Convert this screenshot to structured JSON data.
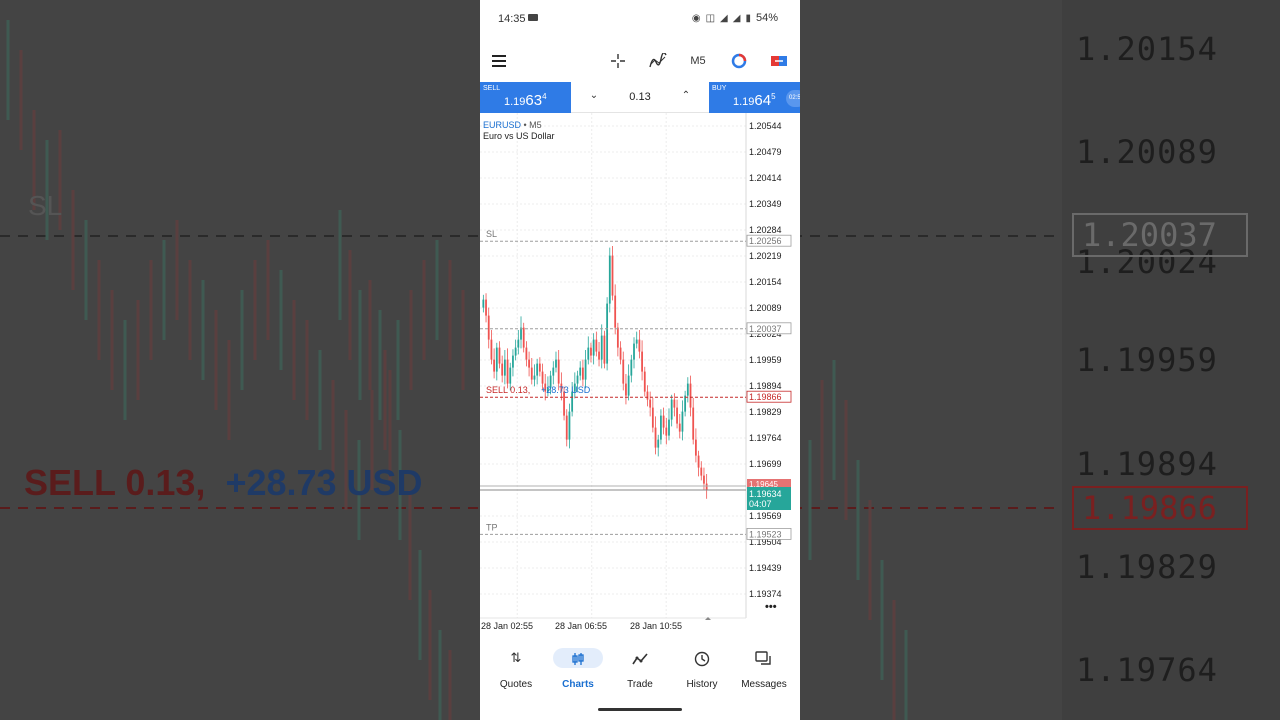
{
  "status_bar": {
    "time": "14:35",
    "battery": "54%"
  },
  "toolbar": {
    "timeframe": "M5",
    "icons": [
      "menu-icon",
      "crosshair-icon",
      "indicators-icon",
      "objects-icon",
      "new-order-icon"
    ]
  },
  "trade_bar": {
    "sell_label": "SELL",
    "sell_price_prefix": "1.19",
    "sell_price_big": "63",
    "sell_price_sup": "4",
    "buy_label": "BUY",
    "buy_price_prefix": "1.19",
    "buy_price_big": "64",
    "buy_price_sup": "5",
    "buy_badge": "02:5",
    "volume": "0.13"
  },
  "chart": {
    "symbol": "EURUSD",
    "timeframe_label": "• M5",
    "description": "Euro vs US Dollar",
    "price_labels": [
      "1.20544",
      "1.20479",
      "1.20414",
      "1.20349",
      "1.20284",
      "1.20219",
      "1.20154",
      "1.20089",
      "1.20024",
      "1.19959",
      "1.19894",
      "1.19829",
      "1.19764",
      "1.19699",
      "1.19569",
      "1.19504",
      "1.19439",
      "1.19374"
    ],
    "sl_label": "SL",
    "sl_price": "1.20256",
    "entry_price": "1.20037",
    "position_text": "SELL 0.13,",
    "position_profit": "+28.73 USD",
    "position_price": "1.19866",
    "current_bid_hidden": "1.19645",
    "current_price": "1.19634",
    "countdown": "04:07",
    "tp_label": "TP",
    "tp_price": "1.19523",
    "time_labels": [
      "28 Jan 02:55",
      "28 Jan 06:55",
      "28 Jan 10:55"
    ],
    "more_label": "•••",
    "colors": {
      "bull": "#26a69a",
      "bear": "#ef5350",
      "sell_line": "#c62828",
      "current": "#26a69a",
      "accent": "#2f7be6"
    }
  },
  "nav": {
    "items": [
      {
        "label": "Quotes",
        "icon": "quotes-icon"
      },
      {
        "label": "Charts",
        "icon": "charts-icon"
      },
      {
        "label": "Trade",
        "icon": "trade-icon"
      },
      {
        "label": "History",
        "icon": "history-icon"
      },
      {
        "label": "Messages",
        "icon": "messages-icon"
      }
    ],
    "active": "Charts"
  },
  "background": {
    "price_labels": [
      "1.20154",
      "1.20089",
      "1.20024",
      "1.19959",
      "1.19894",
      "1.19829",
      "1.19764"
    ],
    "boxed_price": "1.20037",
    "boxed_red_price": "1.19866",
    "sell_text": "SELL 0.13,",
    "profit_text": "+28.73 USD",
    "sl_text": "SL"
  }
}
